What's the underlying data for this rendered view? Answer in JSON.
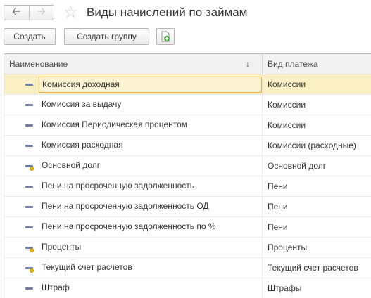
{
  "header": {
    "back_icon": "arrow-left-icon",
    "forward_icon": "arrow-right-icon",
    "favorite_icon": "star-icon",
    "title": "Виды начислений по займам"
  },
  "toolbar": {
    "create_label": "Создать",
    "create_group_label": "Создать группу",
    "copy_icon": "add-document-icon"
  },
  "table": {
    "columns": [
      "Наименование",
      "Вид платежа"
    ],
    "sort_icon": "sort-down-icon",
    "rows": [
      {
        "name": "Комиссия доходная",
        "type": "Комиссии",
        "selected": true,
        "icon": "item-icon"
      },
      {
        "name": "Комиссия за выдачу",
        "type": "Комиссии",
        "selected": false,
        "icon": "item-icon"
      },
      {
        "name": "Комиссия Периодическая процентом",
        "type": "Комиссии",
        "selected": false,
        "icon": "item-icon"
      },
      {
        "name": "Комиссия расходная",
        "type": "Комиссии (расходные)",
        "selected": false,
        "icon": "item-icon"
      },
      {
        "name": "Основной долг",
        "type": "Основной долг",
        "selected": false,
        "icon": "predefined-item-icon"
      },
      {
        "name": "Пени на просроченную задолженность",
        "type": "Пени",
        "selected": false,
        "icon": "item-icon"
      },
      {
        "name": "Пени на просроченную задолженность ОД",
        "type": "Пени",
        "selected": false,
        "icon": "item-icon"
      },
      {
        "name": "Пени на просроченную задолженность по %",
        "type": "Пени",
        "selected": false,
        "icon": "item-icon"
      },
      {
        "name": "Проценты",
        "type": "Проценты",
        "selected": false,
        "icon": "predefined-item-icon"
      },
      {
        "name": "Текущий счет расчетов",
        "type": "Текущий счет расчетов",
        "selected": false,
        "icon": "predefined-item-icon"
      },
      {
        "name": "Штраф",
        "type": "Штрафы",
        "selected": false,
        "icon": "item-icon"
      }
    ]
  }
}
